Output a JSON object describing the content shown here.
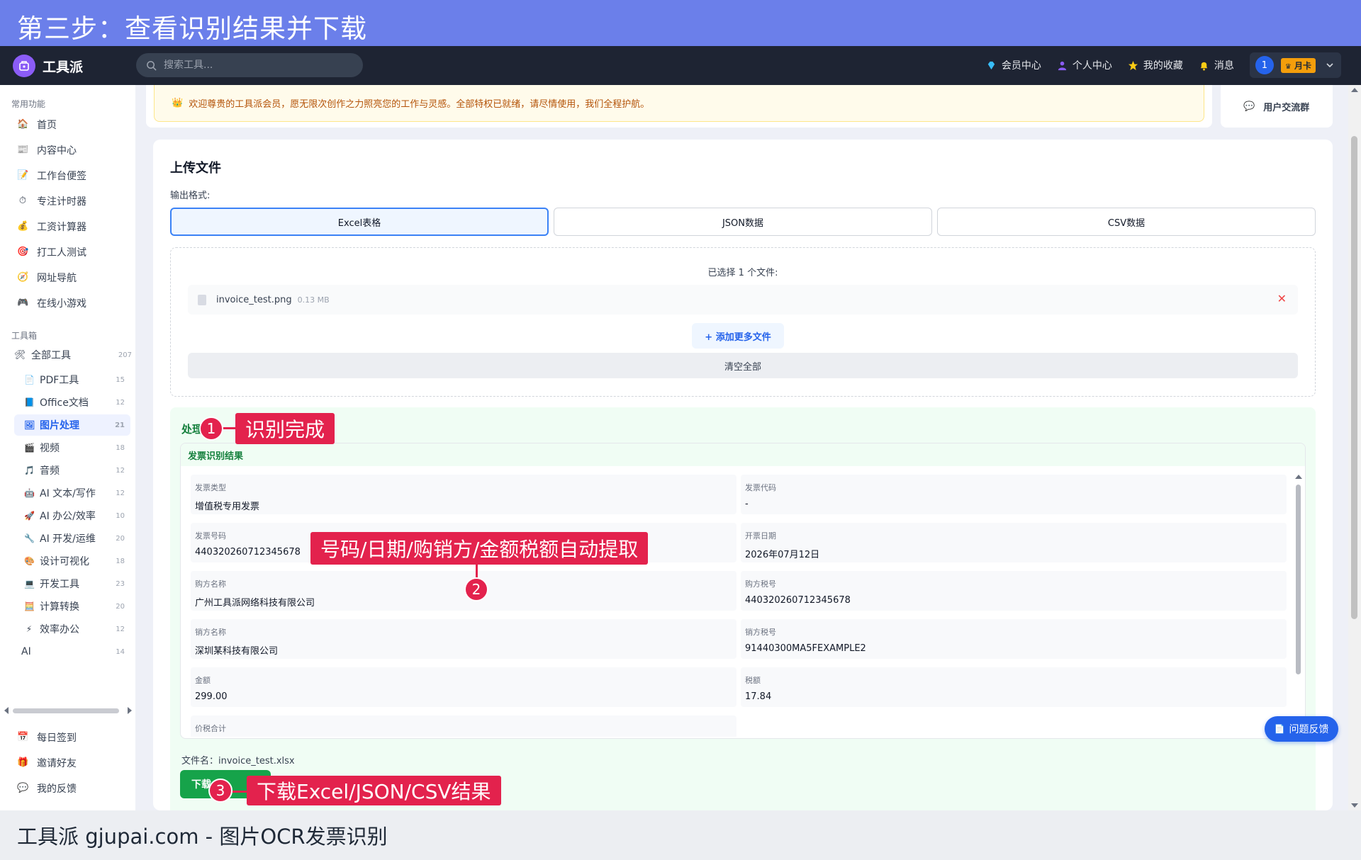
{
  "banner": {
    "title": "第三步：查看识别结果并下载"
  },
  "header": {
    "logo_text": "工具派",
    "search_placeholder": "搜索工具...",
    "nav": [
      {
        "label": "会员中心",
        "icon": "diamond-icon"
      },
      {
        "label": "个人中心",
        "icon": "person-icon"
      },
      {
        "label": "我的收藏",
        "icon": "star-icon"
      },
      {
        "label": "消息",
        "icon": "bell-icon"
      }
    ],
    "user": {
      "avatar": "1",
      "vip": "月卡"
    }
  },
  "sidebar": {
    "common_title": "常用功能",
    "common": [
      {
        "label": "首页",
        "icon": "🏠"
      },
      {
        "label": "内容中心",
        "icon": "📰"
      },
      {
        "label": "工作台便签",
        "icon": "📝"
      },
      {
        "label": "专注计时器",
        "icon": "⏱"
      },
      {
        "label": "工资计算器",
        "icon": "💰"
      },
      {
        "label": "打工人测试",
        "icon": "🎯"
      },
      {
        "label": "网址导航",
        "icon": "🧭"
      },
      {
        "label": "在线小游戏",
        "icon": "🎮"
      }
    ],
    "toolbox_title": "工具箱",
    "all_tools": {
      "label": "全部工具",
      "count": "207",
      "icon": "🛠"
    },
    "tools": [
      {
        "label": "PDF工具",
        "count": "15",
        "icon": "📄"
      },
      {
        "label": "Office文档",
        "count": "12",
        "icon": "📘"
      },
      {
        "label": "图片处理",
        "count": "21",
        "icon": "🖼",
        "active": true
      },
      {
        "label": "视频",
        "count": "18",
        "icon": "🎬"
      },
      {
        "label": "音频",
        "count": "12",
        "icon": "🎵"
      },
      {
        "label": "AI 文本/写作",
        "count": "12",
        "icon": "🤖"
      },
      {
        "label": "AI 办公/效率",
        "count": "10",
        "icon": "🚀"
      },
      {
        "label": "AI 开发/运维",
        "count": "20",
        "icon": "🔧"
      },
      {
        "label": "设计可视化",
        "count": "18",
        "icon": "🎨"
      },
      {
        "label": "开发工具",
        "count": "23",
        "icon": "💻"
      },
      {
        "label": "计算转换",
        "count": "20",
        "icon": "🧮"
      },
      {
        "label": "效率办公",
        "count": "12",
        "icon": "⚡"
      },
      {
        "label": "AI",
        "count": "14",
        "icon": ""
      }
    ],
    "bottom": [
      {
        "label": "每日签到",
        "icon": "📅"
      },
      {
        "label": "邀请好友",
        "icon": "🎁"
      },
      {
        "label": "我的反馈",
        "icon": "💬"
      }
    ]
  },
  "notice": {
    "text": "欢迎尊贵的工具派会员，愿无限次创作之力照亮您的工作与灵感。全部特权已就绪，请尽情使用，我们全程护航。"
  },
  "community": {
    "label": "用户交流群"
  },
  "upload": {
    "title": "上传文件",
    "format_label": "输出格式:",
    "formats": [
      "Excel表格",
      "JSON数据",
      "CSV数据"
    ],
    "selected_count": "已选择 1 个文件:",
    "file": {
      "name": "invoice_test.png",
      "size": "0.13 MB"
    },
    "add_more": "+ 添加更多文件",
    "clear_all": "清空全部"
  },
  "result": {
    "head": "处理",
    "card_title": "发票识别结果",
    "fields": [
      {
        "label": "发票类型",
        "value": "增值税专用发票"
      },
      {
        "label": "发票代码",
        "value": "-"
      },
      {
        "label": "发票号码",
        "value": "440320260712345678"
      },
      {
        "label": "开票日期",
        "value": "2026年07月12日"
      },
      {
        "label": "购方名称",
        "value": "广州工具派网络科技有限公司"
      },
      {
        "label": "购方税号",
        "value": "440320260712345678"
      },
      {
        "label": "销方名称",
        "value": "深圳某科技有限公司"
      },
      {
        "label": "销方税号",
        "value": "91440300MA5FEXAMPLE2"
      },
      {
        "label": "金额",
        "value": "299.00"
      },
      {
        "label": "税额",
        "value": "17.84"
      },
      {
        "label": "价税合计",
        "value": ""
      }
    ],
    "filename_line": "文件名：invoice_test.xlsx",
    "download_label": "下载"
  },
  "feedback": {
    "label": "问题反馈"
  },
  "callouts": [
    {
      "num": "1",
      "text": "识别完成"
    },
    {
      "num": "2",
      "text": "号码/日期/购销方/金额税额自动提取"
    },
    {
      "num": "3",
      "text": "下载Excel/JSON/CSV结果"
    }
  ],
  "caption": {
    "text": "工具派 gjupai.com - 图片OCR发票识别"
  },
  "colors": {
    "banner": "#6b7fea",
    "appbar": "#1e2433",
    "accent": "#2563eb",
    "callout": "#e3224d",
    "success": "#16a34a"
  }
}
